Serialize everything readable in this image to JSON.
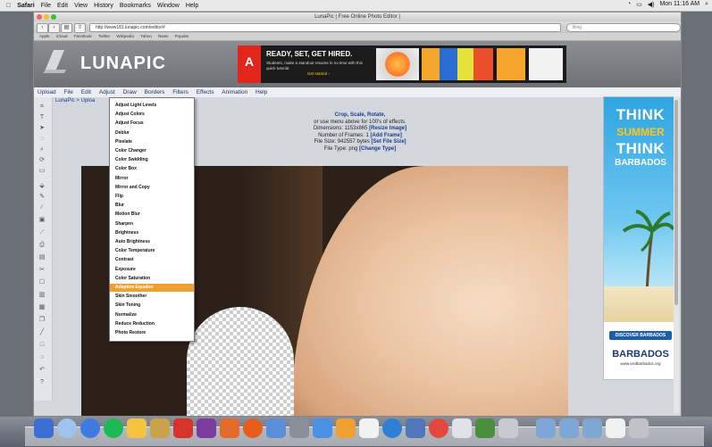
{
  "menubar": {
    "apple": "",
    "items": [
      "Safari",
      "File",
      "Edit",
      "View",
      "History",
      "Bookmarks",
      "Window",
      "Help"
    ],
    "clock": "Mon 11:16 AM"
  },
  "browser": {
    "window_title": "LunaPic | Free Online Photo Editor |",
    "url": "http://www181.lunapic.com/editor/#",
    "search_placeholder": "Bing",
    "bookmarks": [
      "Apple",
      "iCloud",
      "Facebook",
      "Twitter",
      "Wikipedia",
      "Yahoo",
      "News",
      "Popular"
    ]
  },
  "site": {
    "logo": "LUNAPIC",
    "ad_headline": "READY, SET, GET HIRED.",
    "ad_body": "Students, make a standout resume in no time with this quick tutorial.",
    "ad_cta": "Get started ›",
    "menu": [
      "Upload",
      "File",
      "Edit",
      "Adjust",
      "Draw",
      "Borders",
      "Filters",
      "Effects",
      "Animation",
      "Help"
    ],
    "breadcrumb": "LunaPic > Uploa",
    "info": {
      "title": "Crop, Scale, Rotate,",
      "line2": "or use menu above for 100's of effects.",
      "dimensions_label": "Dimensions: 1153x865",
      "dimensions_link": "[Resize Image]",
      "frames_label": "Number of Frames: 1",
      "frames_link": "[Add Frame]",
      "filesize_label": "File Size: 942557 bytes",
      "filesize_link": "[Set File Size]",
      "filetype_label": "File Type: png",
      "filetype_link": "[Change Type]"
    }
  },
  "adjust_menu": [
    "Adjust Light Levels",
    "Adjust Colors",
    "Adjust Focus",
    "Deblur",
    "Pixelate",
    "Color Changer",
    "Color Swidding",
    "Color Box",
    "Mirror",
    "Mirror and Copy",
    "Flip",
    "Blur",
    "Motion Blur",
    "Sharpen",
    "Brightness",
    "Auto Brightness",
    "Color Temperature",
    "Contrast",
    "Exposure",
    "Color Saturation",
    "Adaptive Equalize",
    "Skin Smoother",
    "Skin Toning",
    "Normalize",
    "Reduce Reduction",
    "Photo Restore"
  ],
  "adjust_menu_highlight_index": 20,
  "side_ad": {
    "think1": "THINK",
    "summer": "SUMMER",
    "think2": "THINK",
    "barbados": "BARBADOS",
    "discover": "DISCOVER BARBADOS",
    "logo": "BARBADOS",
    "url": "www.visitbarbados.org"
  },
  "colors": {
    "highlight": "#f0a030",
    "link": "#1a3c8c",
    "ad_blue": "#2ea5e0"
  }
}
